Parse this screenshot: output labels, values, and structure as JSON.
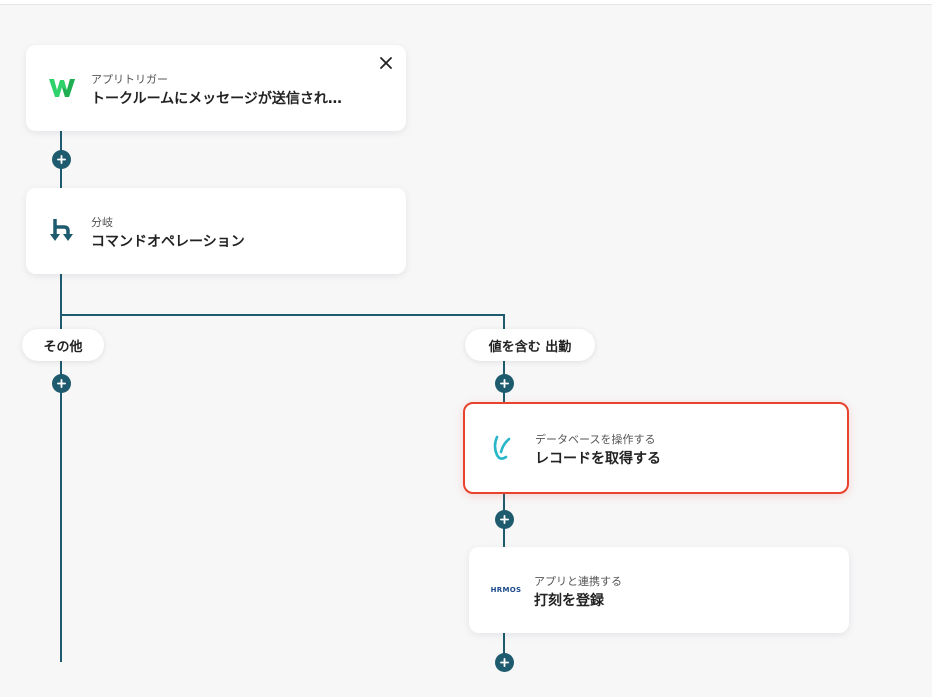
{
  "nodes": {
    "trigger": {
      "subtitle": "アプリトリガー",
      "title": "トークルームにメッセージが送信され…"
    },
    "branch": {
      "subtitle": "分岐",
      "title": "コマンドオペレーション"
    },
    "database": {
      "subtitle": "データベースを操作する",
      "title": "レコードを取得する"
    },
    "app": {
      "subtitle": "アプリと連携する",
      "title": "打刻を登録",
      "logo_text": "HRMOS"
    }
  },
  "branches": {
    "other_label": "その他",
    "contains_label": "値を含む 出勤"
  },
  "colors": {
    "connector": "#1f5b6f",
    "selected_border": "#e8442d",
    "worksmobile_green": "#2fd16b",
    "yoom_teal": "#29b6c9",
    "hrmos_blue": "#1b4a8c"
  }
}
